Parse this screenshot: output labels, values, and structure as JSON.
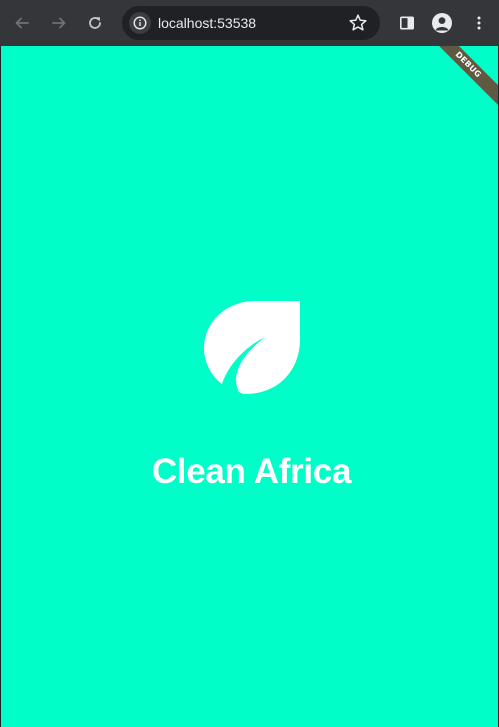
{
  "browser": {
    "url": "localhost:53538",
    "icons": {
      "back": "arrow-left-icon",
      "forward": "arrow-right-icon",
      "reload": "reload-icon",
      "site_info": "info-icon",
      "bookmark": "star-icon",
      "side_panel": "side-panel-icon",
      "profile": "avatar-icon",
      "menu": "kebab-menu-icon"
    }
  },
  "app": {
    "title": "Clean Africa",
    "logo_icon": "leaf-icon",
    "debug_label": "DEBUG",
    "colors": {
      "background": "#00ffc8",
      "foreground": "#ffffff",
      "debug_banner": "#6e3c28"
    }
  }
}
